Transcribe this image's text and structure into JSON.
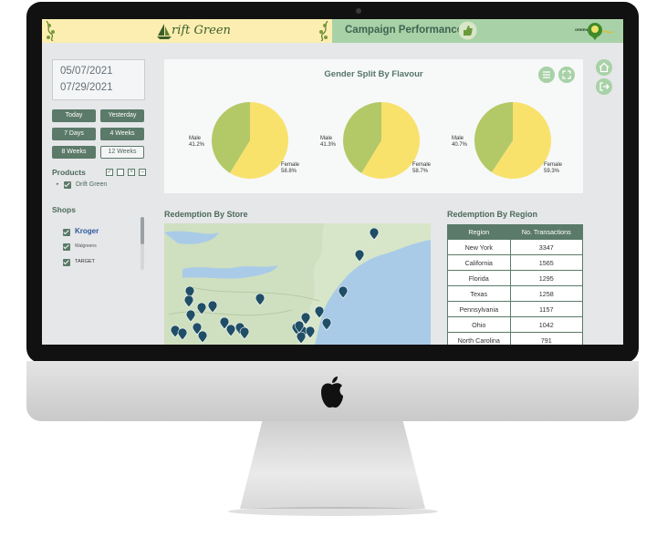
{
  "header": {
    "brand_name": "rift Green",
    "page_title": "Campaign Performance",
    "logo_text": "GREEN"
  },
  "date_range": {
    "start": "05/07/2021",
    "end": "07/29/2021"
  },
  "quick_ranges": [
    "Today",
    "Yesterday",
    "7 Days",
    "4 Weeks",
    "8 Weeks",
    "12 Weeks"
  ],
  "products": {
    "label": "Products",
    "items": [
      "Drift Green"
    ]
  },
  "shops": {
    "label": "Shops",
    "items": [
      "Kroger",
      "Walgreens",
      "TARGET"
    ]
  },
  "chart_card": {
    "title": "Gender Split By Flavour"
  },
  "chart_data": {
    "type": "pie",
    "title": "Gender Split By Flavour",
    "pies": [
      {
        "categories": [
          "Male",
          "Female"
        ],
        "values": [
          41.2,
          58.8
        ],
        "labels": [
          "41.2%",
          "58.8%"
        ]
      },
      {
        "categories": [
          "Male",
          "Female"
        ],
        "values": [
          41.3,
          58.7
        ],
        "labels": [
          "41.3%",
          "58.7%"
        ]
      },
      {
        "categories": [
          "Male",
          "Female"
        ],
        "values": [
          40.7,
          59.3
        ],
        "labels": [
          "40.7%",
          "59.3%"
        ]
      }
    ],
    "colors": {
      "Male": "#b3c967",
      "Female": "#f8e26c"
    }
  },
  "map": {
    "title": "Redemption By Store"
  },
  "region_table": {
    "title": "Redemption By Region",
    "columns": [
      "Region",
      "No. Transactions"
    ],
    "rows": [
      [
        "New York",
        "3347"
      ],
      [
        "California",
        "1565"
      ],
      [
        "Florida",
        "1295"
      ],
      [
        "Texas",
        "1258"
      ],
      [
        "Pennsylvania",
        "1157"
      ],
      [
        "Ohio",
        "1042"
      ],
      [
        "North Carolina",
        "791"
      ]
    ]
  },
  "colors": {
    "accent_dark": "#5b7a69",
    "accent_light": "#a8d1a7",
    "brand_bar": "#fbeeb0"
  },
  "icons": [
    "menu-icon",
    "fullscreen-icon",
    "home-icon",
    "logout-icon",
    "thumbs-up-icon",
    "apple-logo-icon"
  ]
}
